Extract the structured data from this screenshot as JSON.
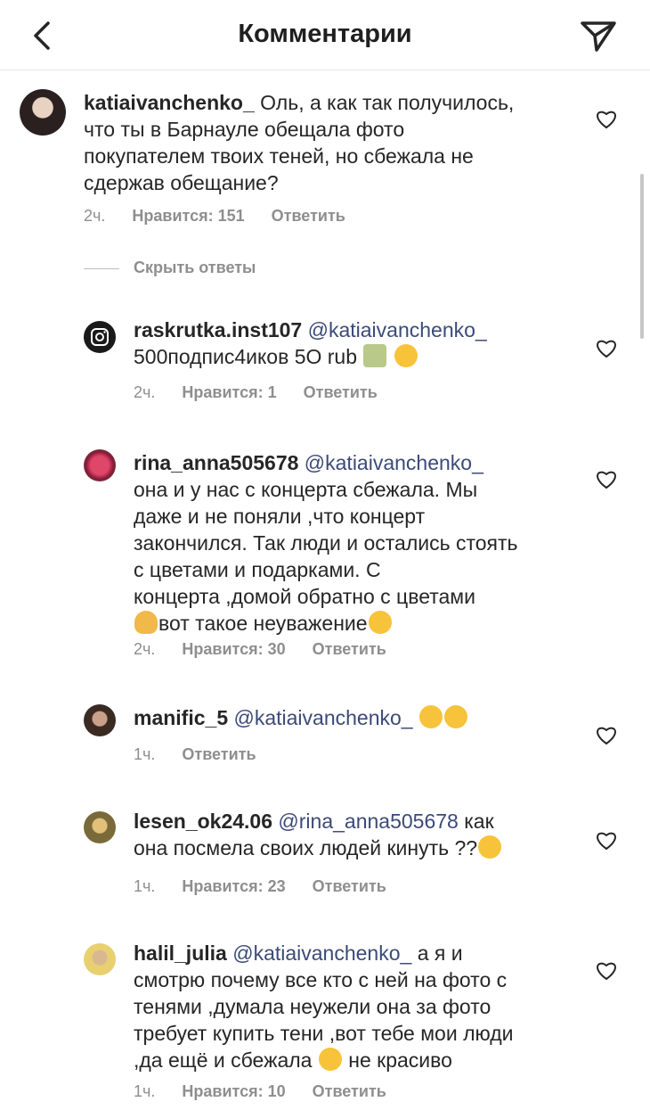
{
  "header": {
    "title": "Комментарии"
  },
  "comments": [
    {
      "username": "katiaivanchenko_",
      "mention": "",
      "lines": [
        "Оль, а как так получилось,",
        "что ты в Барнауле обещала фото",
        "покупателем твоих теней, но сбежала не",
        "сдержав обещание?"
      ],
      "time": "2ч.",
      "likes": "Нравится: 151",
      "reply": "Ответить"
    },
    {
      "username": "raskrutka.inst107",
      "mention": "@katiaivanchenko_",
      "lines": [
        "500подпис4иков 5О rub"
      ],
      "emojis": [
        "money",
        "heart-eyes"
      ],
      "time": "2ч.",
      "likes": "Нравится: 1",
      "reply": "Ответить"
    },
    {
      "username": "rina_anna505678",
      "mention": "@katiaivanchenko_",
      "lines": [
        "она и у нас с концерта сбежала. Мы",
        "даже и не поняли ,что концерт",
        "закончился. Так люди и остались стоять",
        "с цветами и подарками. С",
        "концерта ,домой обратно с цветами",
        "вот такое неуважение"
      ],
      "time": "2ч.",
      "likes": "Нравится: 30",
      "reply": "Ответить"
    },
    {
      "username": "manific_5",
      "mention": "@katiaivanchenko_",
      "emojis": [
        "joy",
        "joy"
      ],
      "time": "1ч.",
      "reply": "Ответить"
    },
    {
      "username": "lesen_ok24.06",
      "mention": "@rina_anna505678",
      "lines": [
        "как",
        "она посмела своих людей кинуть ??"
      ],
      "time": "1ч.",
      "likes": "Нравится: 23",
      "reply": "Ответить"
    },
    {
      "username": "halil_julia",
      "mention": "@katiaivanchenko_",
      "lines": [
        "а я и",
        "смотрю почему все кто с ней на фото с",
        "тенями ,думала неужели  она за фото",
        "требует купить тени ,вот тебе мои люди",
        ",да ещё и сбежала",
        "не красиво"
      ],
      "time": "1ч.",
      "likes": "Нравится: 10",
      "reply": "Ответить"
    }
  ],
  "hide_replies": "Скрыть ответы",
  "colors": {
    "text": "#262626",
    "meta": "#8e8e8e",
    "mention": "#3b4a78",
    "divider": "#e6e6e6"
  }
}
